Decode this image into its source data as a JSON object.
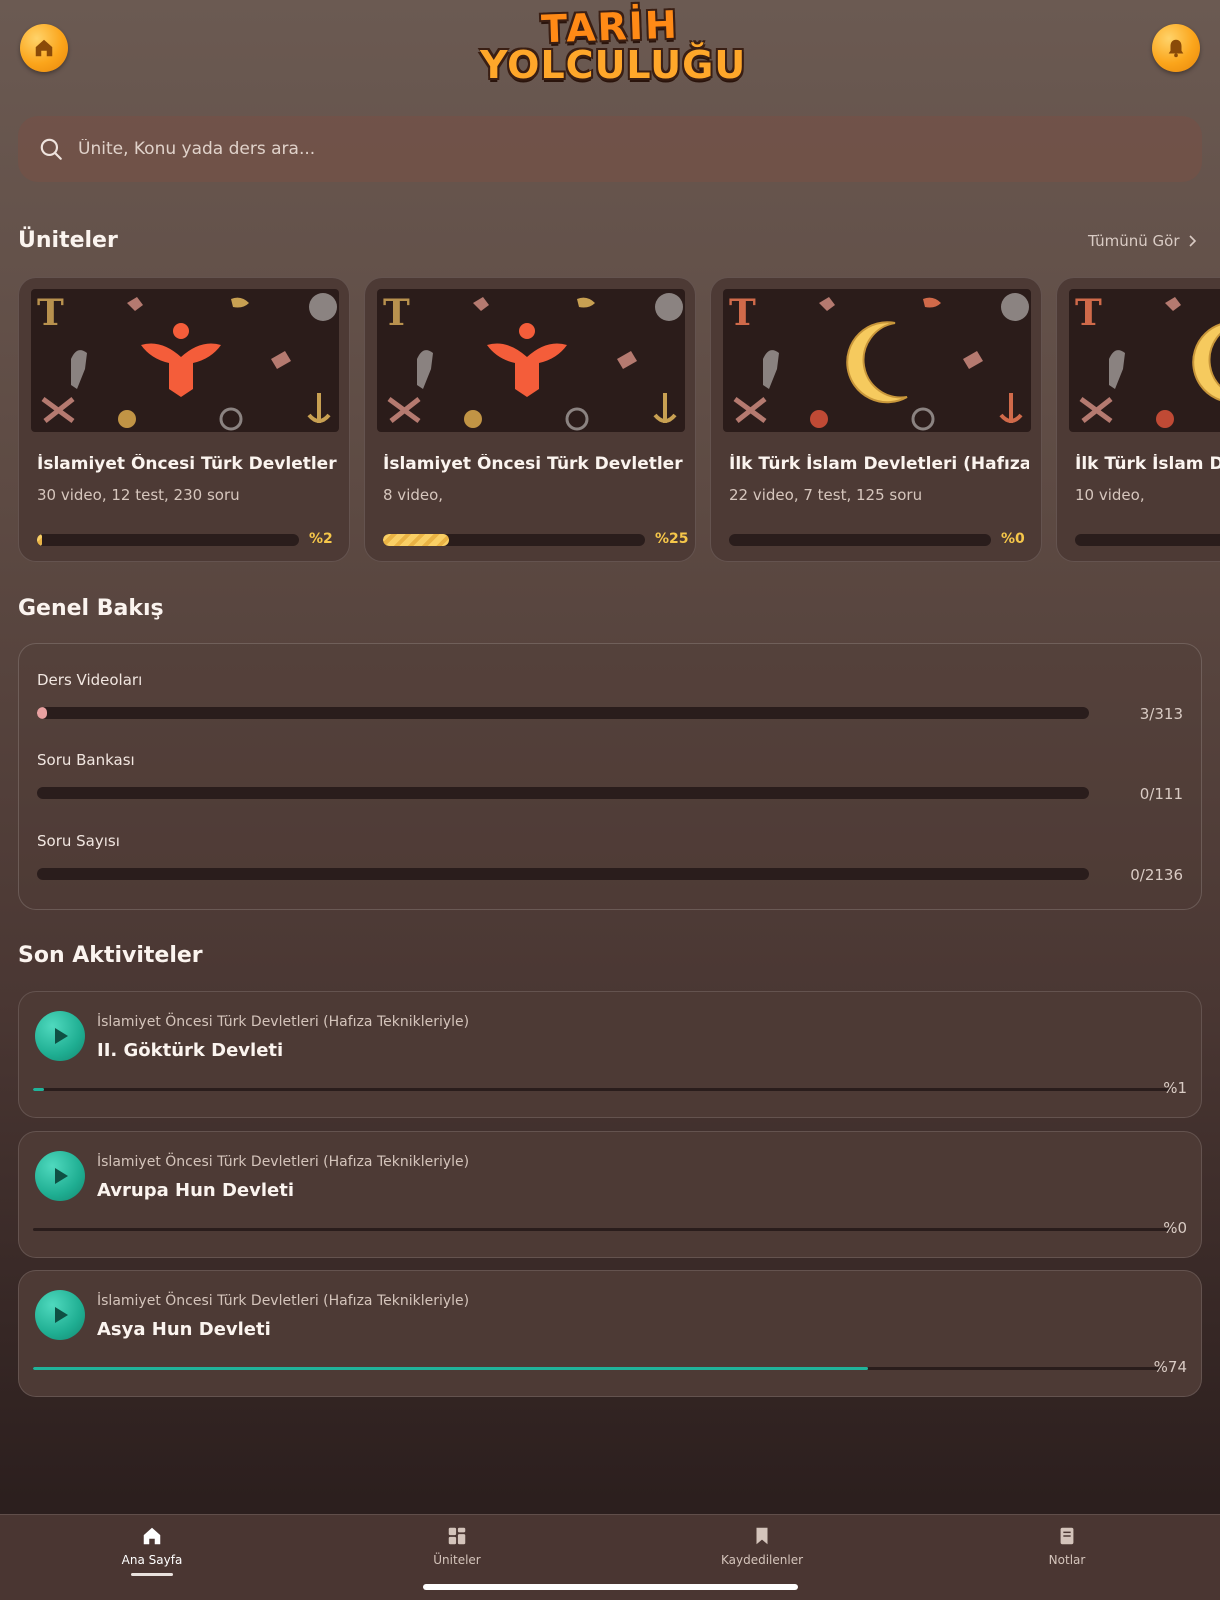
{
  "header": {
    "logo_line1": "TARİH",
    "logo_line2": "YOLCULUĞU",
    "home_icon": "home-icon",
    "bell_icon": "bell-icon"
  },
  "search": {
    "placeholder": "Ünite, Konu yada ders ara..."
  },
  "units_section": {
    "title": "Üniteler",
    "see_all": "Tümünü Gör",
    "cards": [
      {
        "title": "İslamiyet Öncesi Türk Devletleri...",
        "subtitle": "30 video, 12 test, 230 soru",
        "progress": 2,
        "progress_label": "%2",
        "emblem": "eagle-icon"
      },
      {
        "title": "İslamiyet Öncesi Türk Devletleri...",
        "subtitle": "8 video,",
        "progress": 25,
        "progress_label": "%25",
        "emblem": "eagle-icon"
      },
      {
        "title": "İlk Türk İslam Devletleri (Hafıza...",
        "subtitle": "22 video, 7 test, 125 soru",
        "progress": 0,
        "progress_label": "%0",
        "emblem": "crescent-icon"
      },
      {
        "title": "İlk Türk İslam De",
        "subtitle": "10 video,",
        "progress": 0,
        "progress_label": "",
        "emblem": "crescent-icon"
      }
    ]
  },
  "overview": {
    "title": "Genel Bakış",
    "rows": [
      {
        "label": "Ders Videoları",
        "count": "3/313",
        "progress": 0.96
      },
      {
        "label": "Soru Bankası",
        "count": "0/111",
        "progress": 0
      },
      {
        "label": "Soru Sayısı",
        "count": "0/2136",
        "progress": 0
      }
    ]
  },
  "activities": {
    "title": "Son Aktiviteler",
    "items": [
      {
        "unit": "İslamiyet Öncesi Türk Devletleri (Hafıza Teknikleriyle)",
        "title": "II. Göktürk Devleti",
        "progress": 1,
        "progress_label": "%1"
      },
      {
        "unit": "İslamiyet Öncesi Türk Devletleri (Hafıza Teknikleriyle)",
        "title": "Avrupa Hun Devleti",
        "progress": 0,
        "progress_label": "%0"
      },
      {
        "unit": "İslamiyet Öncesi Türk Devletleri (Hafıza Teknikleriyle)",
        "title": "Asya Hun Devleti",
        "progress": 74,
        "progress_label": "%74"
      }
    ]
  },
  "bottom_nav": {
    "items": [
      {
        "label": "Ana Sayfa",
        "icon": "home-icon",
        "active": true
      },
      {
        "label": "Üniteler",
        "icon": "grid-icon",
        "active": false
      },
      {
        "label": "Kaydedilenler",
        "icon": "bookmark-icon",
        "active": false
      },
      {
        "label": "Notlar",
        "icon": "notebook-icon",
        "active": false
      }
    ]
  },
  "colors": {
    "accent_orange": "#fba51b",
    "progress_yellow": "#f6c74a",
    "activity_teal": "#20b39a",
    "overview_fill": "#e9a1a1"
  }
}
